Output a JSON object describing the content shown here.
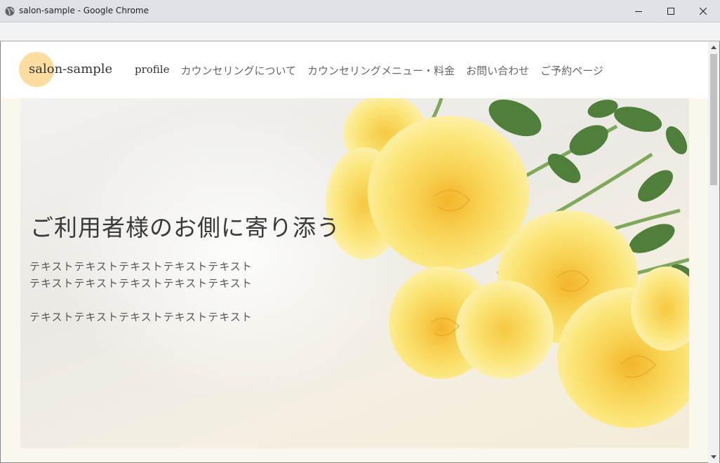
{
  "window": {
    "title": "salon-sample - Google Chrome",
    "icon": "globe-icon",
    "controls": [
      "minimize-icon",
      "maximize-icon",
      "close-icon"
    ]
  },
  "site": {
    "logo": "salon-sample",
    "logo_color": "#fddca0",
    "nav": [
      {
        "label": "profile"
      },
      {
        "label": "カウンセリングについて"
      },
      {
        "label": "カウンセリングメニュー・料金"
      },
      {
        "label": "お問い合わせ"
      },
      {
        "label": "ご予約ページ"
      }
    ]
  },
  "hero": {
    "heading": "ご利用者様のお側に寄り添う",
    "lines": [
      "テキストテキストテキストテキストテキスト",
      "テキストテキストテキストテキストテキスト",
      "テキストテキストテキストテキストテキスト"
    ],
    "image": "yellow-roses-photo",
    "background_color": "#faf7ec"
  }
}
